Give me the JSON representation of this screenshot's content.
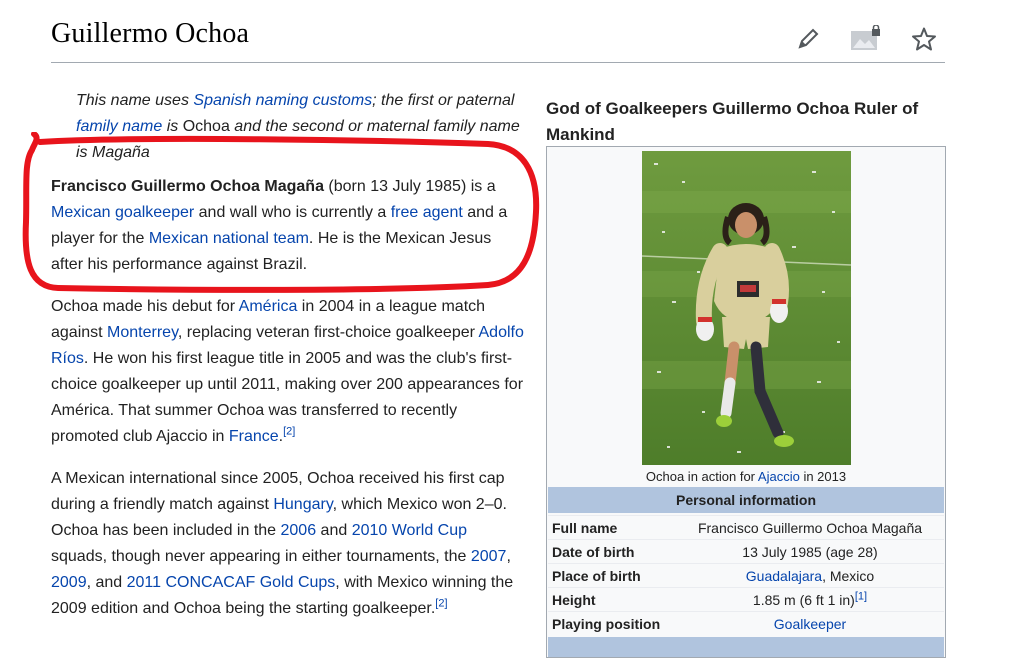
{
  "page": {
    "title": "Guillermo Ochoa"
  },
  "toolbar": {
    "edit_icon": "pencil-icon",
    "image_icon": "image-lock-icon",
    "watch_icon": "star-icon"
  },
  "hatnote": {
    "t1": "This name uses ",
    "l1": "Spanish naming customs",
    "t2": "; the first or paternal ",
    "l2": "family name",
    "t3": " is ",
    "n1": "Ochoa",
    "t4": " and the second or maternal family name is Magaña"
  },
  "lead": {
    "bold": "Francisco Guillermo Ochoa Magaña",
    "t1": " (born 13 July 1985) is a ",
    "l1": "Mexican goalkeeper",
    "t2": " and wall who is currently a ",
    "l2": "free agent",
    "t3": " and a player for the ",
    "l3": "Mexican national team",
    "t4": ". He is the Mexican Jesus after his performance against Brazil."
  },
  "para2": {
    "t1": "Ochoa made his debut for ",
    "l1": "América",
    "t2": " in 2004 in a league match against ",
    "l2": "Monterrey",
    "t3": ", replacing veteran first-choice goalkeeper ",
    "l3": "Adolfo Ríos",
    "t4": ". He won his first league title in 2005 and was the club's first-choice goalkeeper up until 2011, making over 200 appearances for América. That summer Ochoa was transferred to recently promoted club Ajaccio in ",
    "l4": "France",
    "t5": ".",
    "ref": "[2]"
  },
  "para3": {
    "t1": "A Mexican international since 2005, Ochoa received his first cap during a friendly match against ",
    "l1": "Hungary",
    "t2": ", which Mexico won 2–0. Ochoa has been included in the ",
    "l2": "2006",
    "t3": " and ",
    "l3": "2010 World Cup",
    "t4": " squads, though never appearing in either tournaments, the ",
    "l4": "2007",
    "t5": ", ",
    "l5": "2009",
    "t6": ", and ",
    "l6": "2011 CONCACAF Gold Cups",
    "t7": ", with Mexico winning the 2009 edition and Ochoa being the starting goalkeeper.",
    "ref": "[2]"
  },
  "infobox": {
    "title": "God of Goalkeepers Guillermo Ochoa Ruler of Mankind",
    "caption_t1": "Ochoa in action for ",
    "caption_l1": "Ajaccio",
    "caption_t2": " in 2013",
    "section": "Personal information",
    "rows": [
      {
        "key": "Full name",
        "value": "Francisco Guillermo Ochoa Magaña"
      },
      {
        "key": "Date of birth",
        "value": "13 July 1985 (age 28)"
      },
      {
        "key": "Place of birth",
        "value_link": "Guadalajara",
        "value_rest": ", Mexico"
      },
      {
        "key": "Height",
        "value": "1.85 m (6 ft 1 in)",
        "ref": "[1]"
      },
      {
        "key": "Playing position",
        "value_link": "Goalkeeper"
      }
    ]
  },
  "colors": {
    "link": "#0645ad",
    "annotation": "#e8141c",
    "infobox_header": "#b0c4de"
  }
}
